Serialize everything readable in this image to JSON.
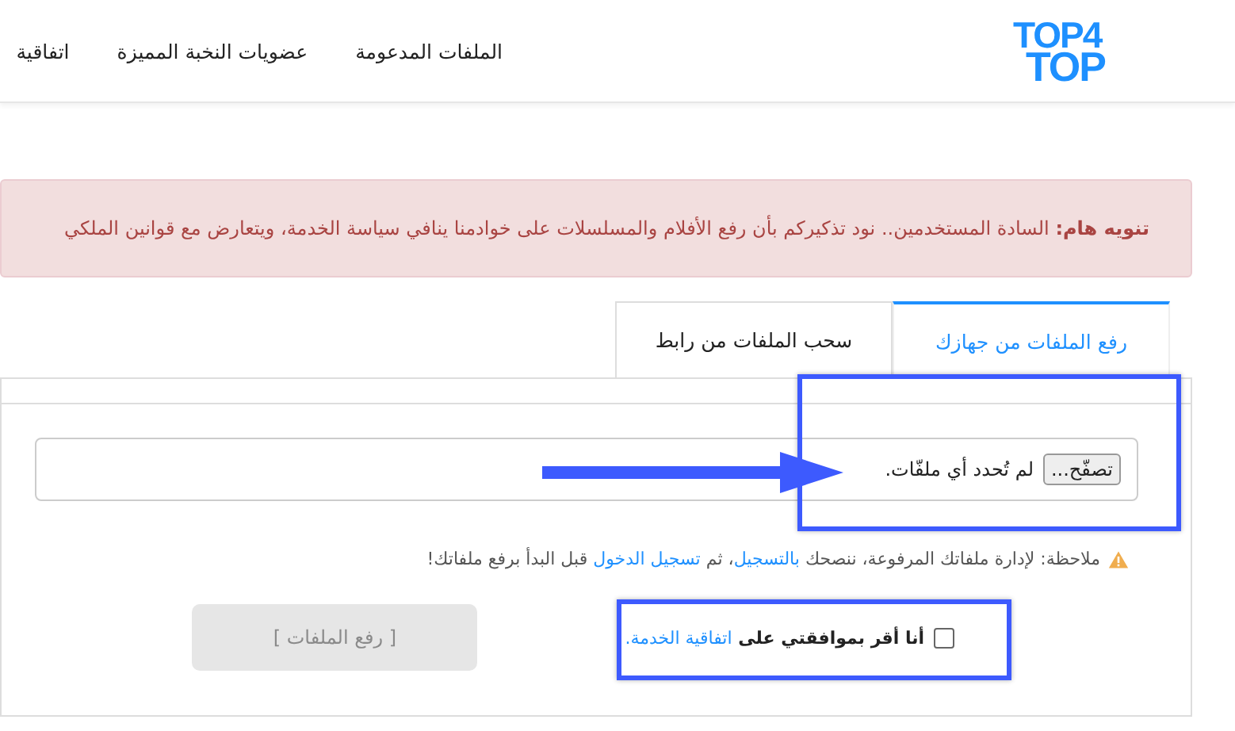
{
  "header": {
    "logo": {
      "line1": "TOP4",
      "line2": "TOP"
    },
    "nav": [
      "الملفات المدعومة",
      "عضويات النخبة المميزة",
      "اتفاقية"
    ]
  },
  "alert": {
    "label": "تنويه هام:",
    "text": "السادة المستخدمين.. نود تذكيركم بأن رفع الأفلام والمسلسلات على خوادمنا ينافي سياسة الخدمة، ويتعارض مع قوانين الملكي"
  },
  "tabs": [
    {
      "label": "رفع الملفات من جهازك",
      "selected": true
    },
    {
      "label": "سحب الملفات من رابط",
      "selected": false
    }
  ],
  "file_input": {
    "button": "تصفّح...",
    "status": "لم تُحدد أي ملفّات."
  },
  "note": {
    "parts": [
      {
        "kind": "text",
        "text": "ملاحظة: لإدارة ملفاتك المرفوعة، ننصحك "
      },
      {
        "kind": "link",
        "text": "بالتسجيل"
      },
      {
        "kind": "text",
        "text": "، ثم "
      },
      {
        "kind": "link",
        "text": "تسجيل الدخول"
      },
      {
        "kind": "text",
        "text": " قبل البدأ برفع ملفاتك!"
      }
    ]
  },
  "agreement": {
    "checked": false,
    "text": "أنا أقر بموافقتي على",
    "link": "اتفاقية الخدمة."
  },
  "upload_button": {
    "label": "[ رفع الملفات ]",
    "disabled": true
  }
}
